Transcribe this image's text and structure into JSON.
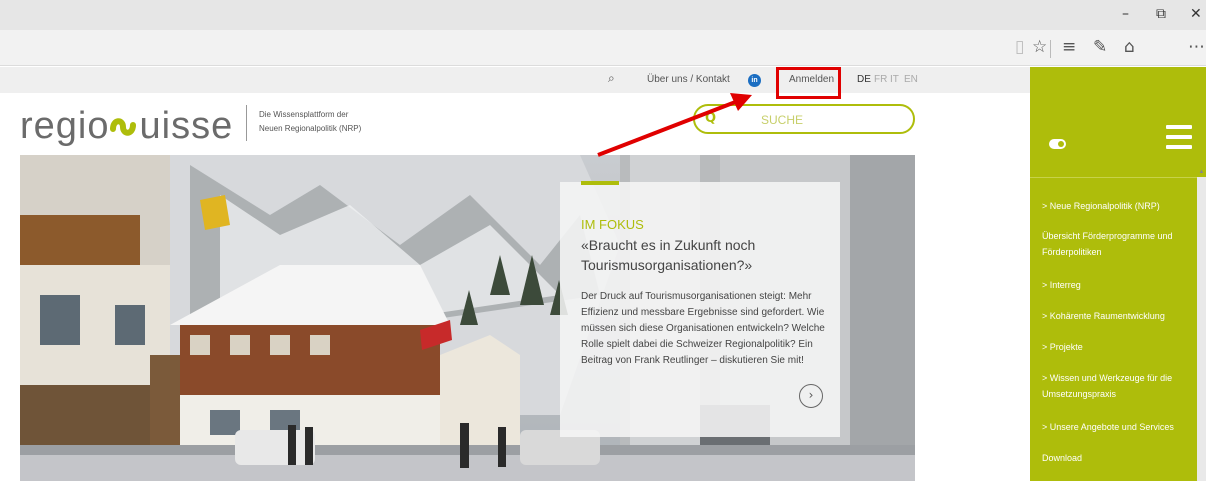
{
  "window": {
    "minimize": "–",
    "restore": "⧉",
    "close": "✕"
  },
  "toolbar": {
    "icons": [
      "reading-view-icon",
      "favorite-icon",
      "hub-icon",
      "web-note-icon",
      "share-icon",
      "more-icon"
    ],
    "reading_view": "▯",
    "favorite": "☆",
    "hub": "≡",
    "web_note": "✎",
    "share": "⌂",
    "more": "⋯"
  },
  "topnav": {
    "search_glyph": "⌕",
    "about": "Über uns / Kontakt",
    "linkedin": "in",
    "login": "Anmelden",
    "lang_de": "DE",
    "lang_fr": "FR",
    "lang_it": "IT",
    "lang_en": "EN"
  },
  "header": {
    "logo_left": "regio",
    "logo_right": "uisse",
    "tagline_line1": "Die Wissensplattform der",
    "tagline_line2": "Neuen Regionalpolitik (NRP)"
  },
  "search": {
    "icon": "search-icon",
    "glyph": "Q",
    "placeholder": "SUCHE"
  },
  "focus": {
    "kicker": "IM FOKUS",
    "title": "«Braucht es in Zukunft noch Tourismusorganisationen?»",
    "text": "Der Druck auf Tourismusorganisationen steigt: Mehr Effizienz und messbare Ergebnisse sind gefordert. Wie müssen sich diese Organisationen entwickeln? Welche Rolle spielt dabei die Schweizer Regionalpolitik? Ein Beitrag von Frank Reutlinger – diskutieren Sie mit!",
    "next": "›"
  },
  "sidebar": {
    "items": [
      {
        "label": "> Neue Regionalpolitik (NRP)"
      },
      {
        "label": "Übersicht Förderprogramme und Förderpolitiken"
      },
      {
        "label": "> Interreg"
      },
      {
        "label": "> Kohärente Raumentwicklung"
      },
      {
        "label": "> Projekte"
      },
      {
        "label": "> Wissen und Werkzeuge für die Umsetzungspraxis"
      },
      {
        "label": "> Unsere Angebote und Services"
      },
      {
        "label": "Download"
      }
    ]
  },
  "colors": {
    "brand": "#aebd0b",
    "highlight": "#e00000"
  }
}
